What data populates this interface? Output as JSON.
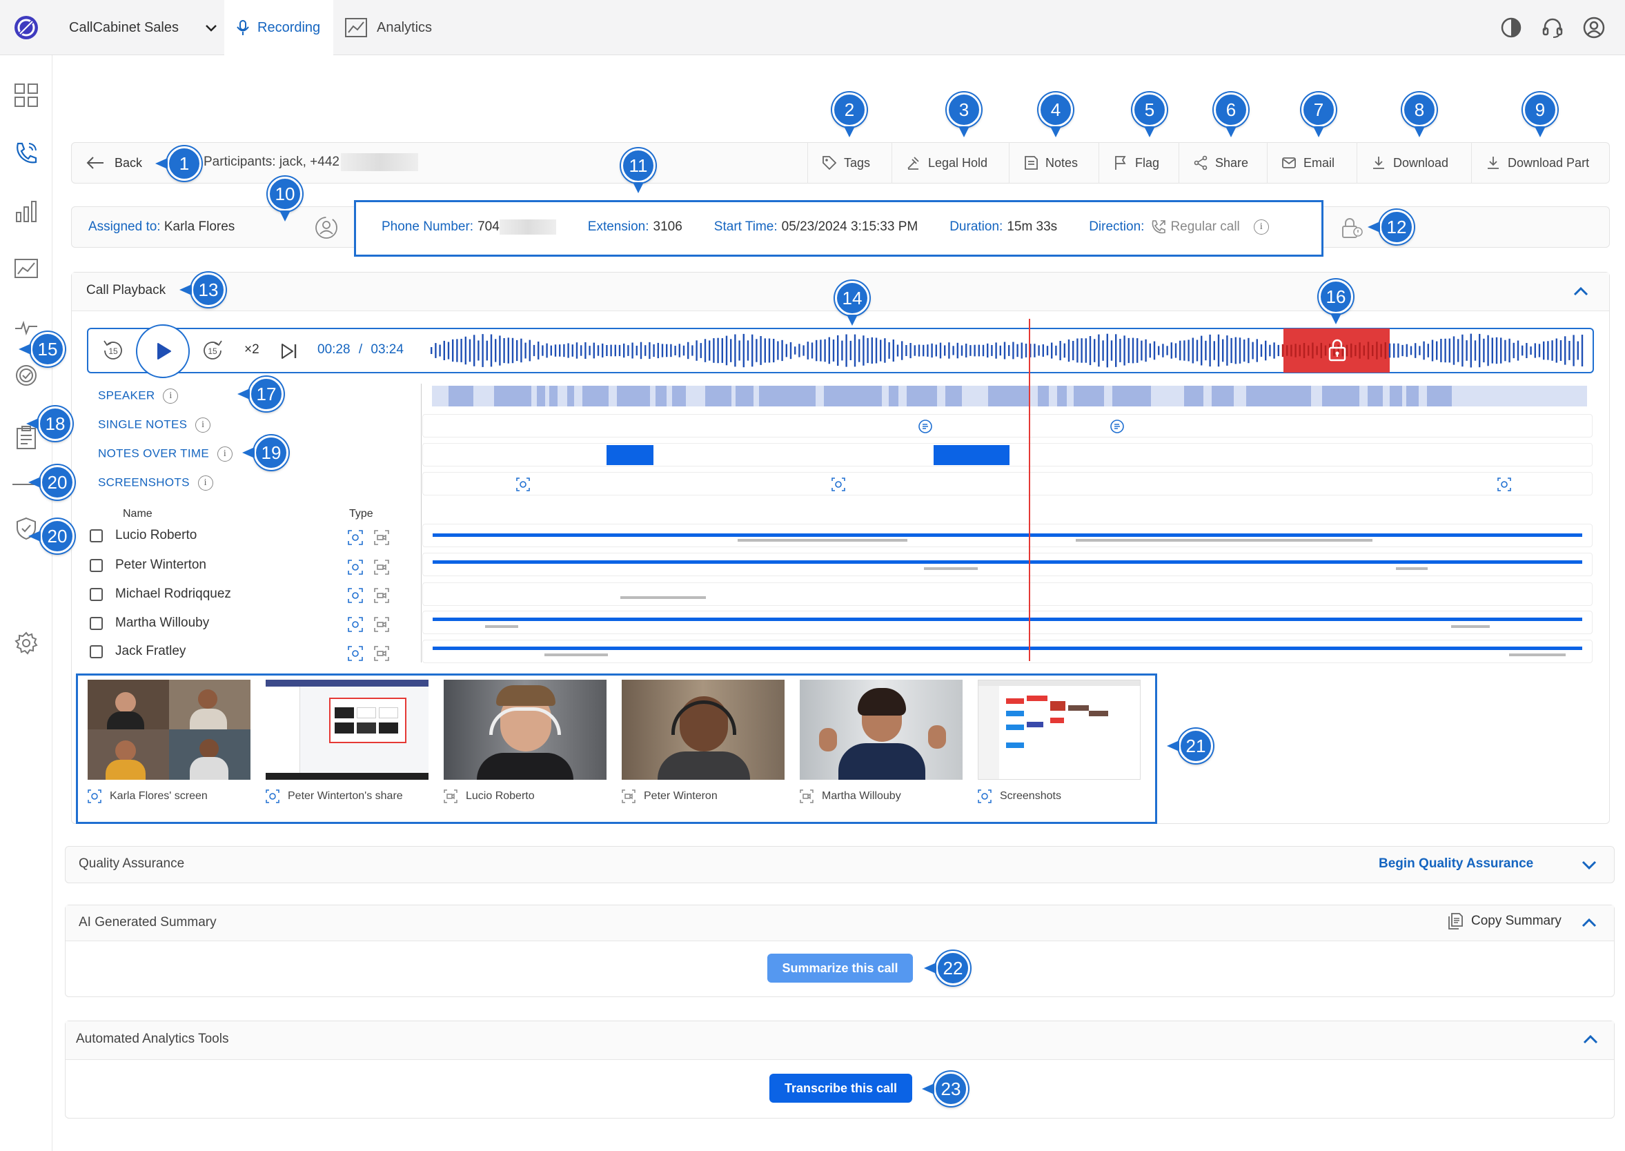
{
  "topbar": {
    "workspace": "CallCabinet Sales",
    "tabs": [
      {
        "label": "Recording",
        "active": true
      },
      {
        "label": "Analytics",
        "active": false
      }
    ]
  },
  "header": {
    "back_label": "Back",
    "participants": "Participants: jack, +442",
    "tools": [
      "Tags",
      "Legal Hold",
      "Notes",
      "Flag",
      "Share",
      "Email",
      "Download",
      "Download Part"
    ]
  },
  "info": {
    "assigned_label": "Assigned to:",
    "assigned_value": "Karla Flores",
    "phone_label": "Phone Number:",
    "phone_value": "704",
    "extension_label": "Extension:",
    "extension_value": "3106",
    "start_label": "Start Time:",
    "start_value": "05/23/2024 3:15:33 PM",
    "duration_label": "Duration:",
    "duration_value": "15m 33s",
    "direction_label": "Direction:",
    "direction_value": "Regular call"
  },
  "playback": {
    "section_title": "Call Playback",
    "skip_back": "15",
    "skip_forward": "15",
    "speed": "×2",
    "current_time": "00:28",
    "separator": "/",
    "total_time": "03:24",
    "playhead_fraction": 0.52,
    "locked_segment": [
      0.74,
      0.83
    ]
  },
  "timeline_labels": {
    "speaker": "SPEAKER",
    "single_notes": "SINGLE NOTES",
    "notes_over_time": "NOTES OVER TIME",
    "screenshots": "SCREENSHOTS"
  },
  "participants_table": {
    "name_header": "Name",
    "type_header": "Type",
    "rows": [
      {
        "name": "Lucio Roberto"
      },
      {
        "name": "Peter Winterton"
      },
      {
        "name": "Michael Rodriqquez"
      },
      {
        "name": "Martha Willouby"
      },
      {
        "name": "Jack Fratley"
      }
    ]
  },
  "media": [
    {
      "caption": "Karla Flores' screen"
    },
    {
      "caption": "Peter Winterton's share"
    },
    {
      "caption": "Lucio Roberto"
    },
    {
      "caption": "Peter Winteron"
    },
    {
      "caption": "Martha Willouby"
    },
    {
      "caption": "Screenshots"
    }
  ],
  "qa": {
    "title": "Quality Assurance",
    "action": "Begin Quality Assurance"
  },
  "summary": {
    "title": "AI Generated Summary",
    "copy": "Copy Summary",
    "button": "Summarize this call"
  },
  "analytics": {
    "title": "Automated Analytics Tools",
    "button": "Transcribe this call"
  },
  "callouts": [
    "1",
    "2",
    "3",
    "4",
    "5",
    "6",
    "7",
    "8",
    "9",
    "10",
    "11",
    "12",
    "13",
    "14",
    "15",
    "16",
    "17",
    "18",
    "19",
    "20",
    "20",
    "21",
    "22",
    "23"
  ],
  "colors": {
    "accent": "#1565c0",
    "wave": "#1f4fb4",
    "lock": "#e03a3a",
    "callout": "#1f6fd1"
  }
}
